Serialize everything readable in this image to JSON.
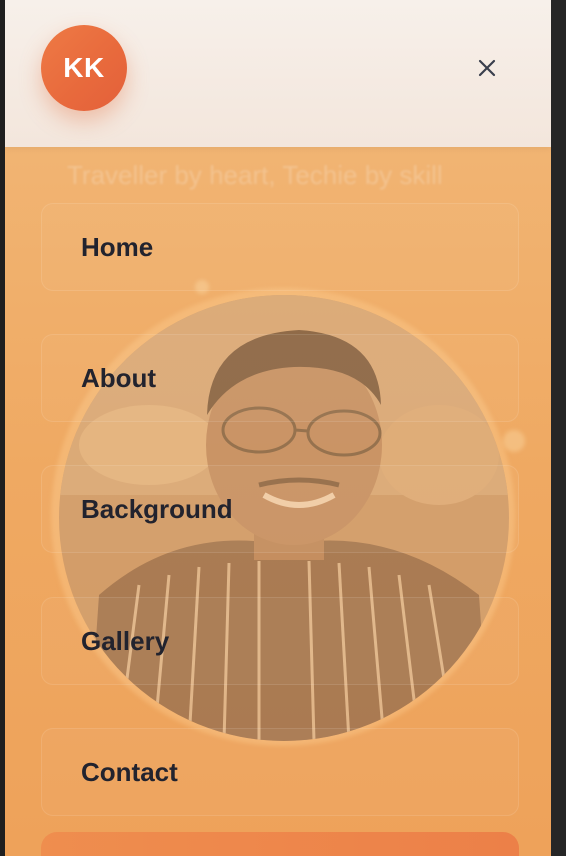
{
  "background": {
    "tagline": "Traveller by heart, Techie by skill"
  },
  "header": {
    "avatar_initials": "KK",
    "close_icon": "close-icon"
  },
  "nav": {
    "items": [
      {
        "label": "Home"
      },
      {
        "label": "About"
      },
      {
        "label": "Background"
      },
      {
        "label": "Gallery"
      },
      {
        "label": "Contact"
      }
    ]
  },
  "colors": {
    "accent": "#e8693c",
    "panel": "#efa962",
    "text": "#22232e"
  }
}
